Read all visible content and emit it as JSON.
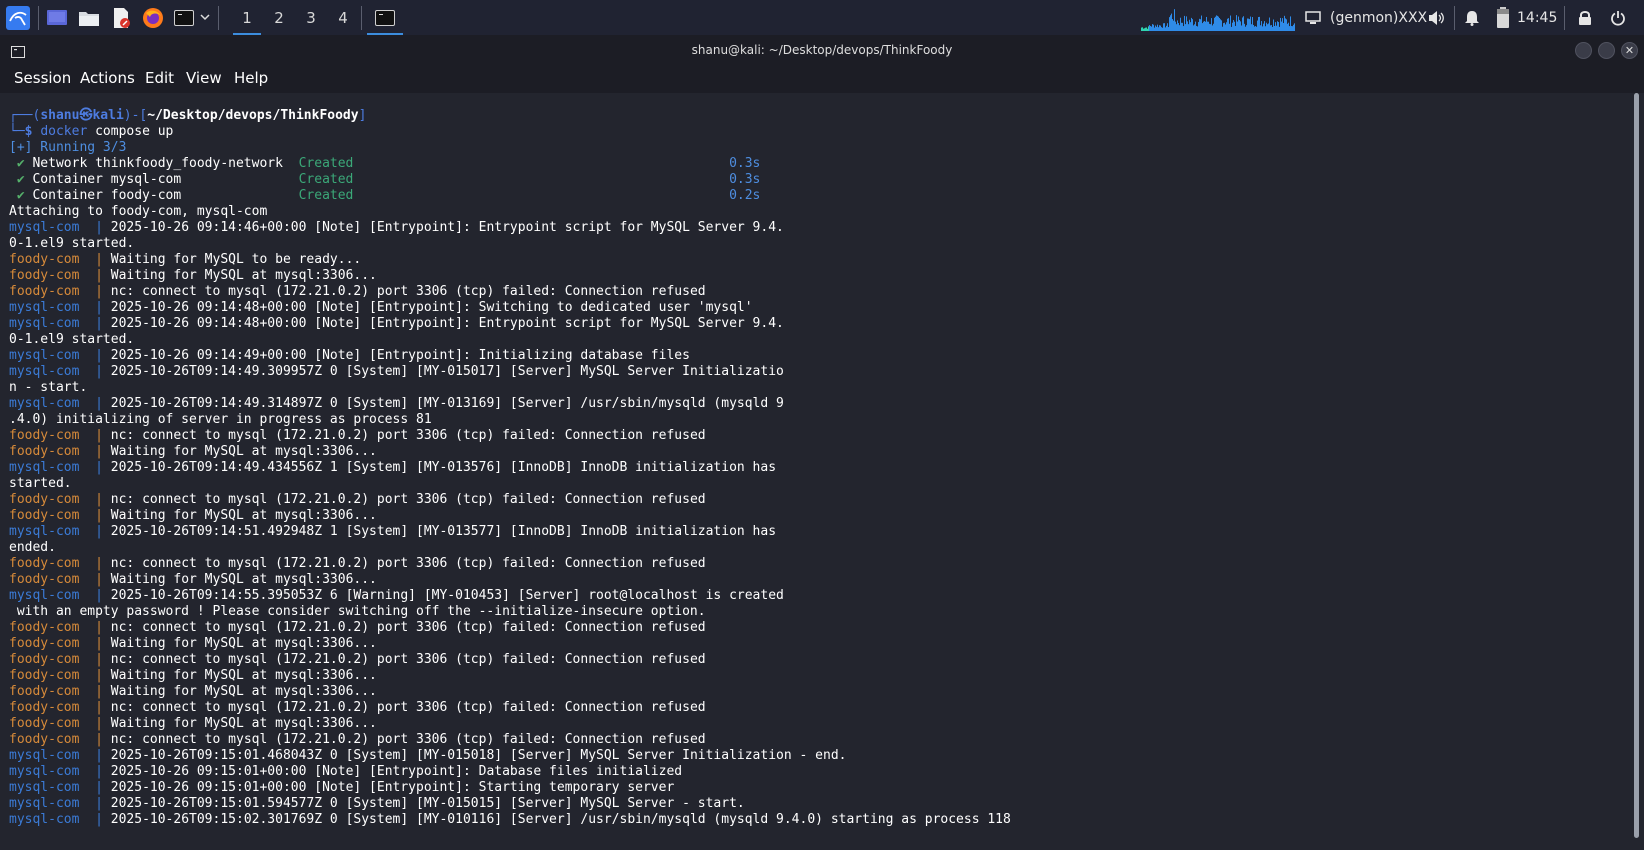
{
  "panel": {
    "workspaces": [
      "1",
      "2",
      "3",
      "4"
    ],
    "active_workspace": "1",
    "genmon_label": "(genmon)XXX",
    "clock": "14:45",
    "icons": [
      "kali-menu-icon",
      "desktop-icon",
      "file-manager-icon",
      "text-editor-icon",
      "firefox-icon",
      "terminal-icon",
      "chevron-down-icon",
      "terminal-task-icon",
      "display-icon",
      "volume-icon",
      "notification-bell-icon",
      "battery-icon",
      "lock-icon",
      "power-icon"
    ]
  },
  "window": {
    "title": "shanu@kali: ~/Desktop/devops/ThinkFoody",
    "menu": [
      "Session",
      "Actions",
      "Edit",
      "View",
      "Help"
    ]
  },
  "terminal": {
    "prompt": {
      "top_open": "┌──(",
      "user": "shanu",
      "at_symbol": "㉿",
      "host": "kali",
      "mid": ")-[",
      "path": "~/Desktop/devops/ThinkFoody",
      "close": "]",
      "bottom": "└─",
      "dollar": "$",
      "command_name": "docker",
      "command_args": " compose up"
    },
    "running": "[+] Running 3/3",
    "created_items": [
      {
        "check": " ✔",
        "name": " Network thinkfoody_foody-network  ",
        "status": "Created",
        "pad": "                                                ",
        "time": "0.3s"
      },
      {
        "check": " ✔",
        "name": " Container mysql-com               ",
        "status": "Created",
        "pad": "                                                ",
        "time": "0.3s"
      },
      {
        "check": " ✔",
        "name": " Container foody-com               ",
        "status": "Created",
        "pad": "                                                ",
        "time": "0.2s"
      }
    ],
    "attaching": "Attaching to foody-com, mysql-com",
    "logs": [
      {
        "svc": "mysql-com",
        "msg": "2025-10-26 09:14:46+00:00 [Note] [Entrypoint]: Entrypoint script for MySQL Server 9.4."
      },
      {
        "svc": "",
        "msg": "0-1.el9 started."
      },
      {
        "svc": "foody-com",
        "msg": "Waiting for MySQL to be ready..."
      },
      {
        "svc": "foody-com",
        "msg": "Waiting for MySQL at mysql:3306..."
      },
      {
        "svc": "foody-com",
        "msg": "nc: connect to mysql (172.21.0.2) port 3306 (tcp) failed: Connection refused"
      },
      {
        "svc": "mysql-com",
        "msg": "2025-10-26 09:14:48+00:00 [Note] [Entrypoint]: Switching to dedicated user 'mysql'"
      },
      {
        "svc": "mysql-com",
        "msg": "2025-10-26 09:14:48+00:00 [Note] [Entrypoint]: Entrypoint script for MySQL Server 9.4."
      },
      {
        "svc": "",
        "msg": "0-1.el9 started."
      },
      {
        "svc": "mysql-com",
        "msg": "2025-10-26 09:14:49+00:00 [Note] [Entrypoint]: Initializing database files"
      },
      {
        "svc": "mysql-com",
        "msg": "2025-10-26T09:14:49.309957Z 0 [System] [MY-015017] [Server] MySQL Server Initializatio"
      },
      {
        "svc": "",
        "msg": "n - start."
      },
      {
        "svc": "mysql-com",
        "msg": "2025-10-26T09:14:49.314897Z 0 [System] [MY-013169] [Server] /usr/sbin/mysqld (mysqld 9"
      },
      {
        "svc": "",
        "msg": ".4.0) initializing of server in progress as process 81"
      },
      {
        "svc": "foody-com",
        "msg": "nc: connect to mysql (172.21.0.2) port 3306 (tcp) failed: Connection refused"
      },
      {
        "svc": "foody-com",
        "msg": "Waiting for MySQL at mysql:3306..."
      },
      {
        "svc": "mysql-com",
        "msg": "2025-10-26T09:14:49.434556Z 1 [System] [MY-013576] [InnoDB] InnoDB initialization has"
      },
      {
        "svc": "",
        "msg": "started."
      },
      {
        "svc": "foody-com",
        "msg": "nc: connect to mysql (172.21.0.2) port 3306 (tcp) failed: Connection refused"
      },
      {
        "svc": "foody-com",
        "msg": "Waiting for MySQL at mysql:3306..."
      },
      {
        "svc": "mysql-com",
        "msg": "2025-10-26T09:14:51.492948Z 1 [System] [MY-013577] [InnoDB] InnoDB initialization has"
      },
      {
        "svc": "",
        "msg": "ended."
      },
      {
        "svc": "foody-com",
        "msg": "nc: connect to mysql (172.21.0.2) port 3306 (tcp) failed: Connection refused"
      },
      {
        "svc": "foody-com",
        "msg": "Waiting for MySQL at mysql:3306..."
      },
      {
        "svc": "mysql-com",
        "msg": "2025-10-26T09:14:55.395053Z 6 [Warning] [MY-010453] [Server] root@localhost is created"
      },
      {
        "svc": "",
        "msg": " with an empty password ! Please consider switching off the --initialize-insecure option."
      },
      {
        "svc": "foody-com",
        "msg": "nc: connect to mysql (172.21.0.2) port 3306 (tcp) failed: Connection refused"
      },
      {
        "svc": "foody-com",
        "msg": "Waiting for MySQL at mysql:3306..."
      },
      {
        "svc": "foody-com",
        "msg": "nc: connect to mysql (172.21.0.2) port 3306 (tcp) failed: Connection refused"
      },
      {
        "svc": "foody-com",
        "msg": "Waiting for MySQL at mysql:3306..."
      },
      {
        "svc": "foody-com",
        "msg": "Waiting for MySQL at mysql:3306..."
      },
      {
        "svc": "foody-com",
        "msg": "nc: connect to mysql (172.21.0.2) port 3306 (tcp) failed: Connection refused"
      },
      {
        "svc": "foody-com",
        "msg": "Waiting for MySQL at mysql:3306..."
      },
      {
        "svc": "foody-com",
        "msg": "nc: connect to mysql (172.21.0.2) port 3306 (tcp) failed: Connection refused"
      },
      {
        "svc": "mysql-com",
        "msg": "2025-10-26T09:15:01.468043Z 0 [System] [MY-015018] [Server] MySQL Server Initialization - end."
      },
      {
        "svc": "mysql-com",
        "msg": "2025-10-26 09:15:01+00:00 [Note] [Entrypoint]: Database files initialized"
      },
      {
        "svc": "mysql-com",
        "msg": "2025-10-26 09:15:01+00:00 [Note] [Entrypoint]: Starting temporary server"
      },
      {
        "svc": "mysql-com",
        "msg": "2025-10-26T09:15:01.594577Z 0 [System] [MY-015015] [Server] MySQL Server - start."
      },
      {
        "svc": "mysql-com",
        "msg": "2025-10-26T09:15:02.301769Z 0 [System] [MY-010116] [Server] /usr/sbin/mysqld (mysqld 9.4.0) starting as process 118"
      }
    ],
    "separator": "  | ",
    "colors": {
      "mysql": "#3b7bd6",
      "foody": "#d68a3a",
      "created": "#3ba878",
      "prompt_blue": "#4d7ce0",
      "background": "#23252e"
    }
  }
}
